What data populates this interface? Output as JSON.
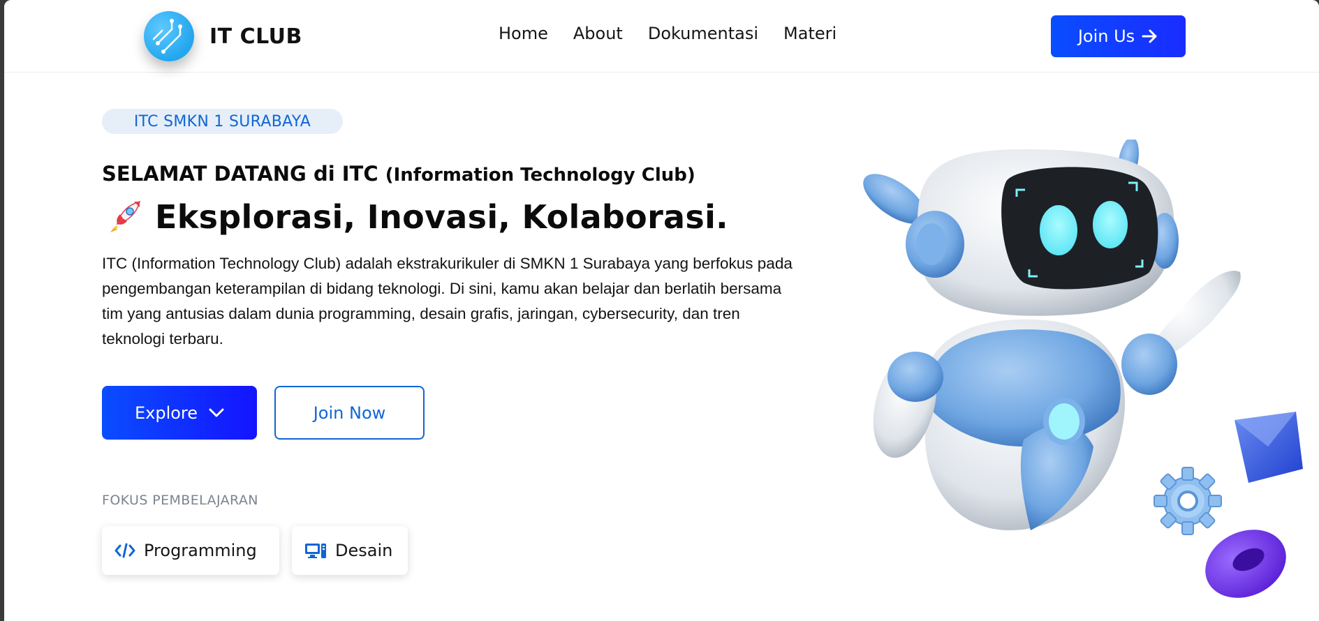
{
  "navbar": {
    "brand": "IT CLUB",
    "links": [
      "Home",
      "About",
      "Dokumentasi",
      "Materi"
    ],
    "cta_label": "Join Us"
  },
  "hero": {
    "badge": "ITC SMKN 1 SURABAYA",
    "welcome_prefix": "SELAMAT DATANG di ITC ",
    "welcome_suffix": "(Information Technology Club)",
    "headline": "Eksplorasi, Inovasi, Kolaborasi.",
    "headline_icon": "rocket-icon",
    "description": "ITC (Information Technology Club) adalah ekstrakurikuler di SMKN 1 Surabaya yang berfokus pada pengembangan keterampilan di bidang teknologi. Di sini, kamu akan belajar dan berlatih bersama tim yang antusias dalam dunia programming, desain grafis, jaringan, cybersecurity, dan tren teknologi terbaru.",
    "explore_label": "Explore",
    "join_now_label": "Join Now"
  },
  "focus": {
    "label": "FOKUS PEMBELAJARAN",
    "items": [
      {
        "label": "Programming",
        "icon": "code-icon"
      },
      {
        "label": "Desain",
        "icon": "desktop-icon"
      }
    ]
  },
  "colors": {
    "primary": "#0a4dff",
    "accent_text": "#1066d6",
    "badge_bg": "#e6eef8"
  }
}
